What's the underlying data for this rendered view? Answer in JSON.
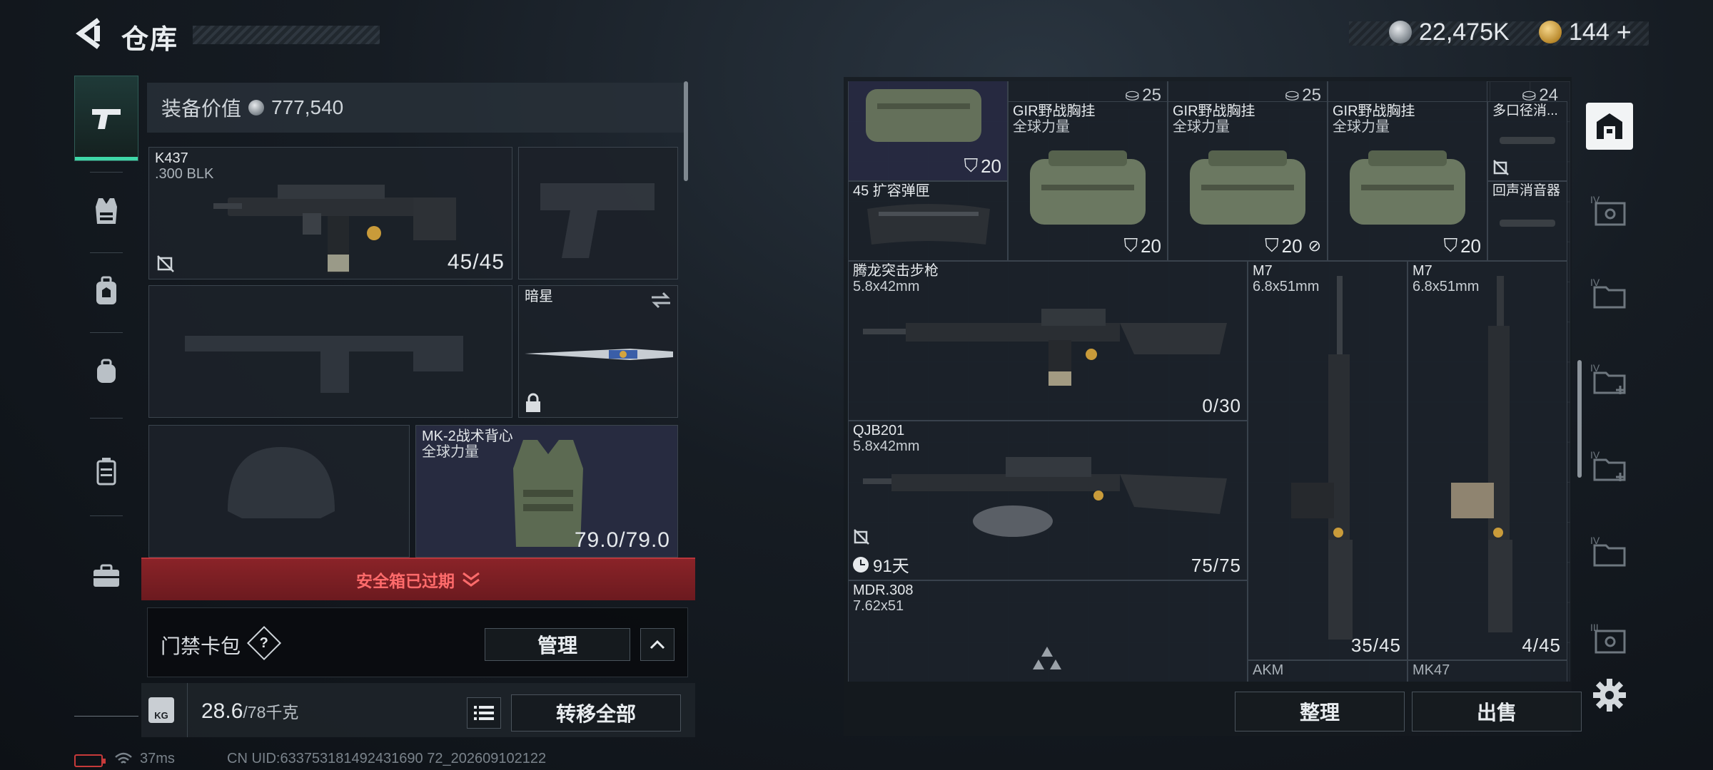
{
  "header": {
    "title": "仓库",
    "currency_silver": "22,475K",
    "currency_gold": "144",
    "currency_gold_suffix": "+"
  },
  "left_rail": [
    {
      "id": "weapons",
      "icon": "pistol-icon",
      "active": true
    },
    {
      "id": "vest",
      "icon": "vest-icon"
    },
    {
      "id": "backpack",
      "icon": "backpack-icon"
    },
    {
      "id": "gear",
      "icon": "helmet-bag-icon"
    },
    {
      "id": "case",
      "icon": "case-icon"
    },
    {
      "id": "toolbox",
      "icon": "toolbox-icon"
    }
  ],
  "loadout": {
    "value_label": "装备价值",
    "value": "777,540",
    "primary": {
      "name": "K437",
      "ammo": ".300 BLK",
      "count": "45/45"
    },
    "melee": {
      "name": "暗星"
    },
    "armor": {
      "name": "MK-2战术背心",
      "brand": "全球力量",
      "durability": "79.0/79.0"
    },
    "safebox_expired": "安全箱已过期",
    "cardbag_label": "门禁卡包",
    "cardbag_help": "?",
    "manage_button": "管理",
    "weight": "28.6",
    "weight_max": "/78千克",
    "weight_icon_label": "KG",
    "transfer_all": "转移全部"
  },
  "status": {
    "ping": "37ms",
    "uid": "CN UID:633753181492431690 72_202609102122"
  },
  "stash": {
    "items": [
      {
        "id": "bag-top-0",
        "count": "20"
      },
      {
        "id": "top-25-a",
        "top": "25"
      },
      {
        "id": "top-25-b",
        "top": "25"
      },
      {
        "id": "top-24",
        "top": "24"
      },
      {
        "id": "gir-1",
        "name": "GIR野战胸挂",
        "brand": "全球力量",
        "count": "20"
      },
      {
        "id": "gir-2",
        "name": "GIR野战胸挂",
        "brand": "全球力量",
        "count": "20"
      },
      {
        "id": "gir-3",
        "name": "GIR野战胸挂",
        "brand": "全球力量",
        "count": "20"
      },
      {
        "id": "multi",
        "name": "多口径消..."
      },
      {
        "id": "mag45",
        "name": "45 扩容弹匣"
      },
      {
        "id": "suppressor",
        "name": "回声消音器"
      },
      {
        "id": "tenglong",
        "name": "腾龙突击步枪",
        "ammo": "5.8x42mm",
        "count": "0/30"
      },
      {
        "id": "qjb201",
        "name": "QJB201",
        "ammo": "5.8x42mm",
        "count": "75/75",
        "timer": "91天"
      },
      {
        "id": "mdr",
        "name": "MDR.308",
        "ammo": "7.62x51"
      },
      {
        "id": "m7-a",
        "name": "M7",
        "ammo": "6.8x51mm",
        "count": "35/45"
      },
      {
        "id": "m7-b",
        "name": "M7",
        "ammo": "6.8x51mm",
        "count": "4/45"
      },
      {
        "id": "akm",
        "name": "AKM"
      },
      {
        "id": "mk47",
        "name": "MK47"
      }
    ],
    "sort_button": "整理",
    "sell_button": "出售"
  },
  "right_rail": [
    {
      "id": "stash-main",
      "icon": "stash-icon",
      "active": true
    },
    {
      "id": "case-4a",
      "icon": "container-icon"
    },
    {
      "id": "case-4b",
      "icon": "folder-icon"
    },
    {
      "id": "case-4c",
      "icon": "folder-add-icon"
    },
    {
      "id": "case-4d",
      "icon": "folder-add-icon"
    },
    {
      "id": "case-4e",
      "icon": "folder-icon"
    },
    {
      "id": "case-3",
      "icon": "container-icon"
    },
    {
      "id": "settings",
      "icon": "gear-icon"
    }
  ],
  "colors": {
    "accent_green": "#3fd7a8",
    "alert_red": "#8a2328",
    "alert_text": "#ff6b6b",
    "highlight_item": "#262a42"
  }
}
